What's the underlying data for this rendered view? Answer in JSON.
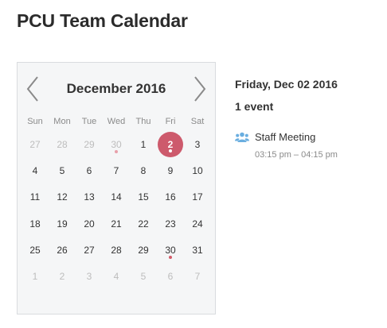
{
  "page": {
    "title": "PCU Team Calendar"
  },
  "calendar": {
    "month_label": "December 2016",
    "weekdays": [
      "Sun",
      "Mon",
      "Tue",
      "Wed",
      "Thu",
      "Fri",
      "Sat"
    ],
    "weeks": [
      [
        {
          "d": "27",
          "other": true
        },
        {
          "d": "28",
          "other": true
        },
        {
          "d": "29",
          "other": true
        },
        {
          "d": "30",
          "other": true,
          "event": true
        },
        {
          "d": "1"
        },
        {
          "d": "2",
          "selected": true,
          "event": true
        },
        {
          "d": "3"
        }
      ],
      [
        {
          "d": "4"
        },
        {
          "d": "5"
        },
        {
          "d": "6"
        },
        {
          "d": "7"
        },
        {
          "d": "8"
        },
        {
          "d": "9"
        },
        {
          "d": "10"
        }
      ],
      [
        {
          "d": "11"
        },
        {
          "d": "12"
        },
        {
          "d": "13"
        },
        {
          "d": "14"
        },
        {
          "d": "15"
        },
        {
          "d": "16"
        },
        {
          "d": "17"
        }
      ],
      [
        {
          "d": "18"
        },
        {
          "d": "19"
        },
        {
          "d": "20"
        },
        {
          "d": "21"
        },
        {
          "d": "22"
        },
        {
          "d": "23"
        },
        {
          "d": "24"
        }
      ],
      [
        {
          "d": "25"
        },
        {
          "d": "26"
        },
        {
          "d": "27"
        },
        {
          "d": "28"
        },
        {
          "d": "29"
        },
        {
          "d": "30",
          "event": true
        },
        {
          "d": "31"
        }
      ],
      [
        {
          "d": "1",
          "other": true
        },
        {
          "d": "2",
          "other": true
        },
        {
          "d": "3",
          "other": true
        },
        {
          "d": "4",
          "other": true
        },
        {
          "d": "5",
          "other": true
        },
        {
          "d": "6",
          "other": true
        },
        {
          "d": "7",
          "other": true
        }
      ]
    ],
    "prev_icon": "chevron-left-icon",
    "next_icon": "chevron-right-icon",
    "accent_color": "#cd5a6c"
  },
  "details": {
    "date": "Friday, Dec 02 2016",
    "count": "1 event",
    "events": [
      {
        "title": "Staff Meeting",
        "time": "03:15 pm – 04:15 pm",
        "icon": "group-icon",
        "icon_color": "#6aaee0"
      }
    ]
  }
}
